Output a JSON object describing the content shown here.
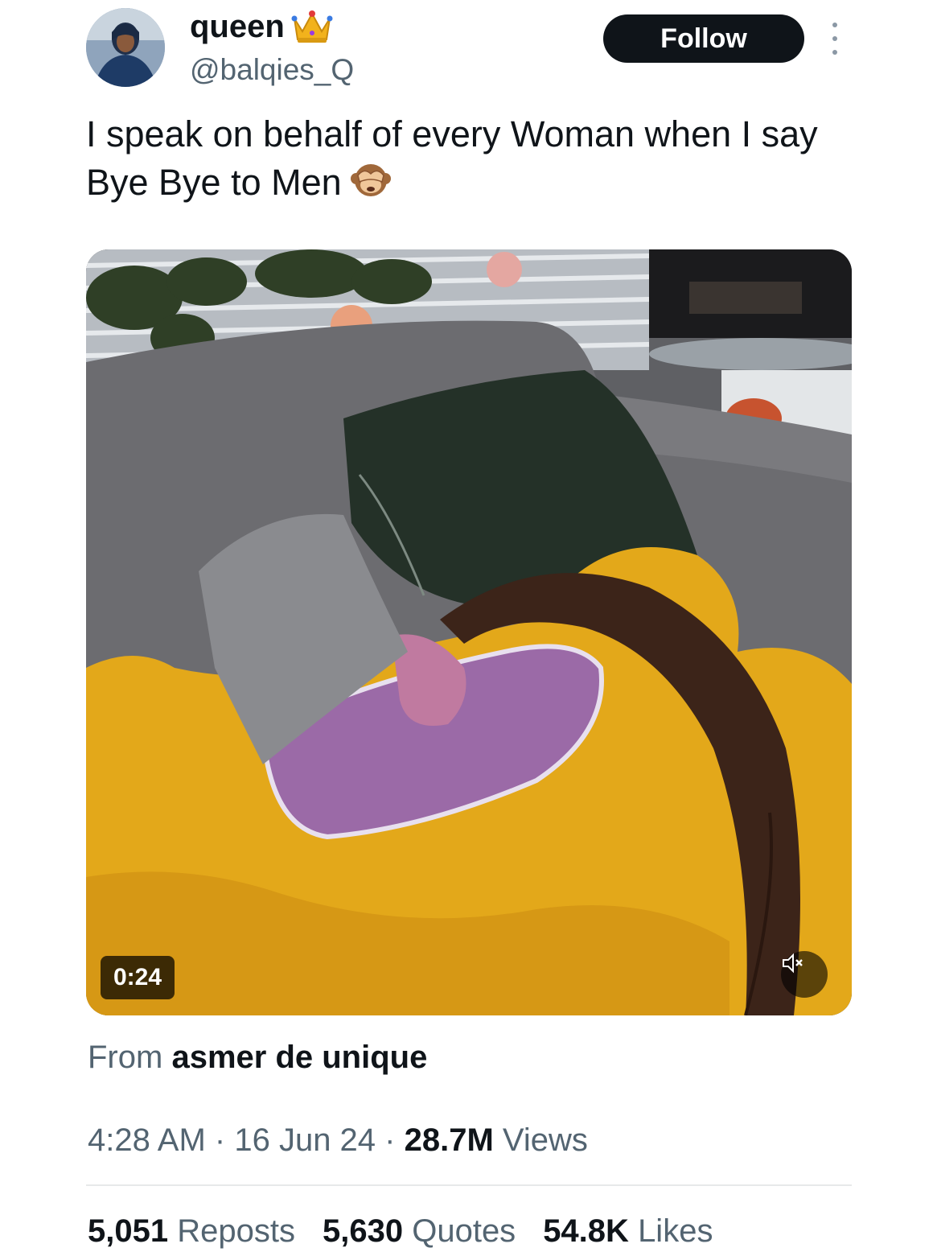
{
  "author": {
    "display_name": "queen",
    "handle": "@balqies_Q",
    "badge_emoji": "crown-icon",
    "follow_label": "Follow"
  },
  "tweet": {
    "text": "I speak on behalf of every Woman when I say Bye Bye to Men",
    "trailing_emoji": "see-no-evil-monkey-icon"
  },
  "media": {
    "duration": "0:24",
    "mute_icon": "speaker-muted-icon"
  },
  "source": {
    "prefix": "From",
    "name": "asmer de unique"
  },
  "meta": {
    "time": "4:28 AM",
    "date": "16 Jun 24",
    "views_count": "28.7M",
    "views_label": "Views",
    "separator": "·"
  },
  "stats": {
    "reposts_count": "5,051",
    "reposts_label": "Reposts",
    "quotes_count": "5,630",
    "quotes_label": "Quotes",
    "likes_count": "54.8K",
    "likes_label": "Likes"
  },
  "colors": {
    "text_primary": "#0f1419",
    "text_secondary": "#536471",
    "follow_bg": "#0f1419",
    "divider": "#e7e9ea"
  }
}
